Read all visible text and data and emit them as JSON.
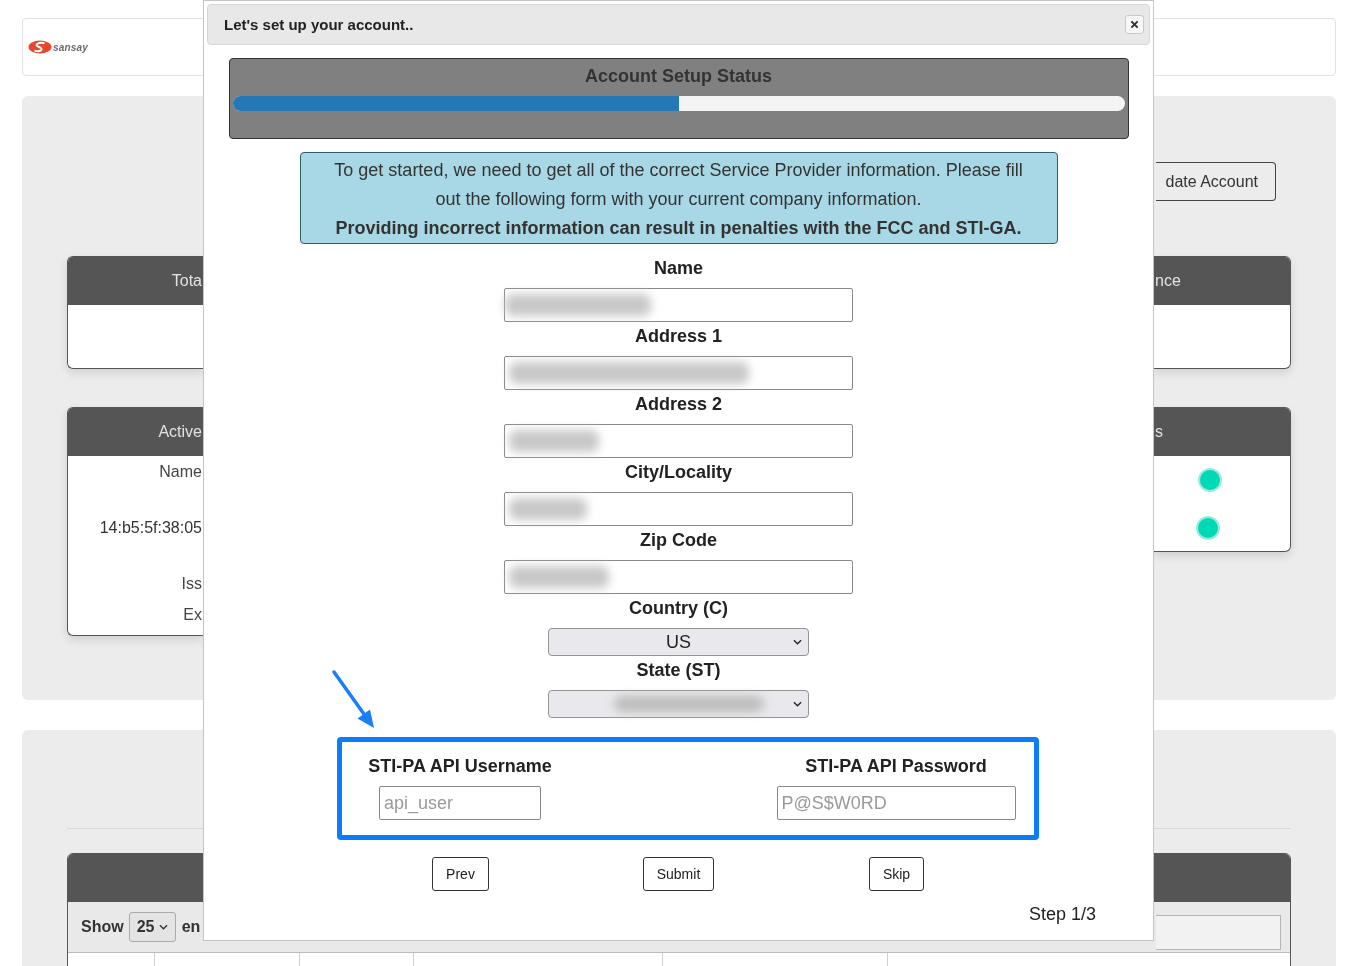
{
  "header": {
    "brand": "sansay"
  },
  "dashboard": {
    "account_button": "date Account",
    "summary_cards": [
      {
        "title": "Tota"
      },
      {
        "title": "nce"
      }
    ],
    "detail_cards": {
      "left": {
        "title": "Active",
        "lines": [
          "Name",
          "14:b5:5f:38:05",
          "Iss",
          "Ex"
        ]
      },
      "right": {
        "title": "s",
        "status_dots": [
          {
            "color": "#00d9b5"
          },
          {
            "color": "#00d9b5"
          }
        ]
      }
    },
    "table": {
      "show_label": "Show",
      "page_size": "25",
      "entries_label": "en"
    }
  },
  "dialog": {
    "title": "Let's set up your account..",
    "status": {
      "title": "Account Setup Status",
      "level": 0.5
    },
    "notice": {
      "text": "To get started, we need to get all of the correct Service Provider information. Please fill out the following form with your current company information.",
      "warning": "Providing incorrect information can result in penalties with the FCC and STI-GA."
    },
    "fields": [
      {
        "kind": "text",
        "label": "Name",
        "redacted": true
      },
      {
        "kind": "text",
        "label": "Address 1",
        "redacted": true
      },
      {
        "kind": "text",
        "label": "Address 2",
        "redacted": true
      },
      {
        "kind": "text",
        "label": "City/Locality",
        "redacted": true
      },
      {
        "kind": "text",
        "label": "Zip Code",
        "redacted": true
      },
      {
        "kind": "select",
        "label": "Country (C)",
        "value": "US",
        "redacted": false
      },
      {
        "kind": "select",
        "label": "State (ST)",
        "redacted": true
      }
    ],
    "api_credentials": [
      {
        "label": "STI-PA API Username",
        "placeholder": "api_user"
      },
      {
        "label": "STI-PA API Password",
        "placeholder": "P@S$W0RD"
      }
    ],
    "buttons": [
      {
        "label": "Prev"
      },
      {
        "label": "Submit"
      },
      {
        "label": "Skip"
      }
    ],
    "step": "Step 1/3"
  }
}
